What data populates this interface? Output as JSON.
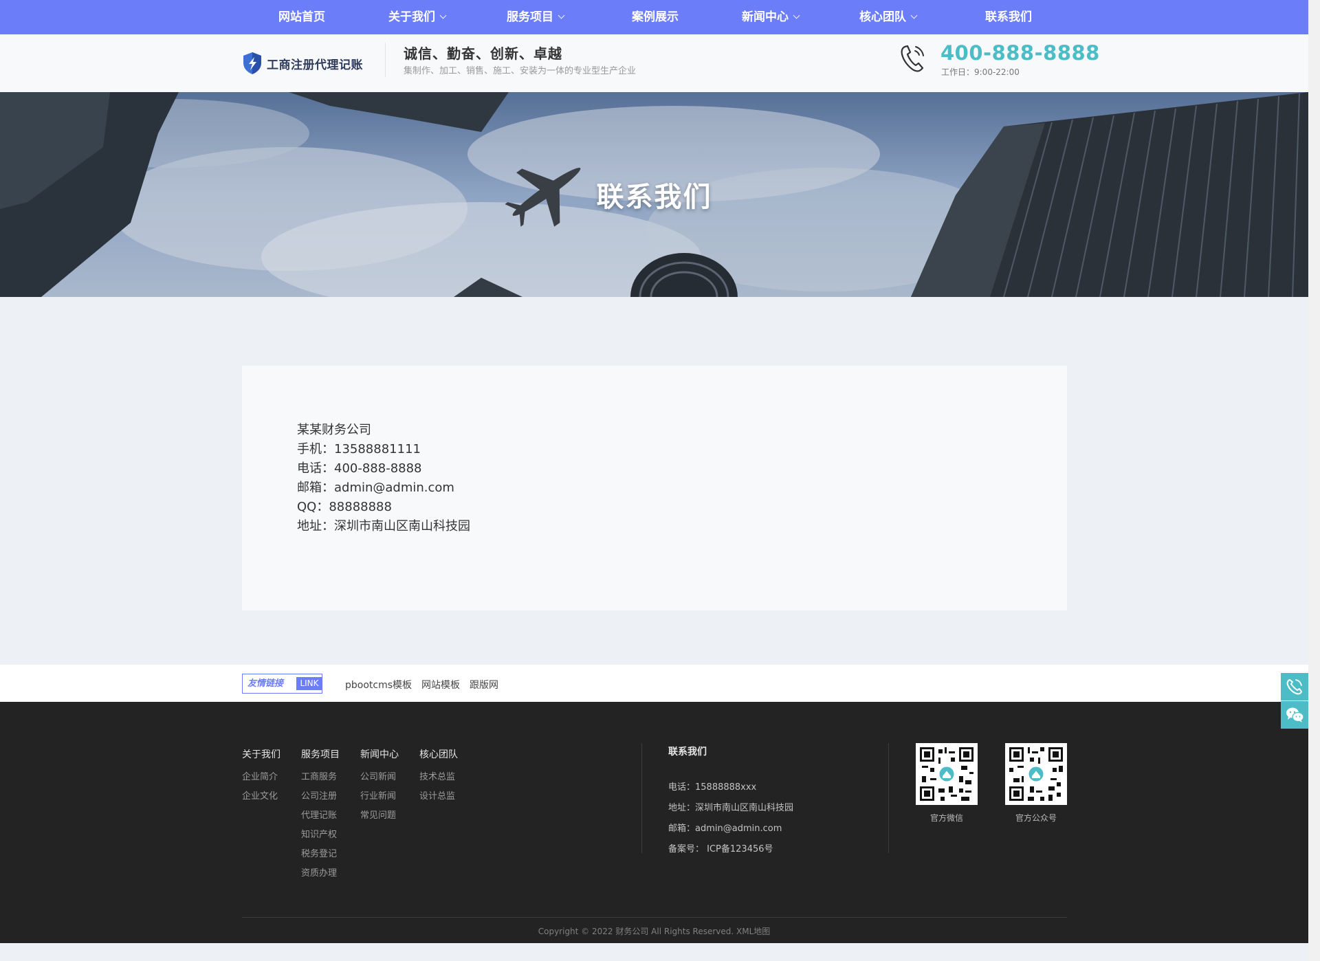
{
  "nav": {
    "items": [
      {
        "label": "网站首页"
      },
      {
        "label": "关于我们"
      },
      {
        "label": "服务项目"
      },
      {
        "label": "案例展示"
      },
      {
        "label": "新闻中心"
      },
      {
        "label": "核心团队"
      },
      {
        "label": "联系我们"
      }
    ]
  },
  "header": {
    "logo_text": "工商注册代理记账",
    "slogan": "诚信、勤奋、创新、卓越",
    "subslogan": "集制作、加工、销售、施工、安装为一体的专业型生产企业",
    "hotline": "400-888-8888",
    "hours": "工作日：9:00-22:00",
    "phone_icon": "phone-icon"
  },
  "banner": {
    "title": "联系我们"
  },
  "contact": {
    "company": "某某财务公司",
    "mobile": "手机：13588881111",
    "phone": "电话：400-888-8888",
    "email": "邮箱：admin@admin.com",
    "qq": "QQ：88888888",
    "address": "地址：深圳市南山区南山科技园"
  },
  "friend_links": {
    "badge_cn": "友情链接",
    "badge_en": "LINK",
    "items": [
      "pbootcms模板",
      "网站模板",
      "跟版网"
    ]
  },
  "footer": {
    "columns": [
      {
        "head": "关于我们",
        "items": [
          "企业简介",
          "企业文化"
        ]
      },
      {
        "head": "服务项目",
        "items": [
          "工商服务",
          "公司注册",
          "代理记账",
          "知识产权",
          "税务登记",
          "资质办理"
        ]
      },
      {
        "head": "新闻中心",
        "items": [
          "公司新闻",
          "行业新闻",
          "常见问题"
        ]
      },
      {
        "head": "核心团队",
        "items": [
          "技术总监",
          "设计总监"
        ]
      }
    ],
    "contact_head": "联系我们",
    "contact_rows": [
      "电话：15888888xxx",
      "地址：深圳市南山区南山科技园",
      "邮箱：admin@admin.com",
      "备案号： ICP备123456号"
    ],
    "qr": [
      {
        "caption": "官方微信"
      },
      {
        "caption": "官方公众号"
      }
    ],
    "copyright": "Copyright © 2022 财务公司 All Rights Reserved. XML地图"
  },
  "side_buttons": {
    "icons": [
      "phone-icon",
      "wechat-icon"
    ]
  },
  "colors": {
    "nav_bg": "#6c7dfa",
    "accent": "#4cbdc6",
    "footer_bg": "#232323"
  }
}
